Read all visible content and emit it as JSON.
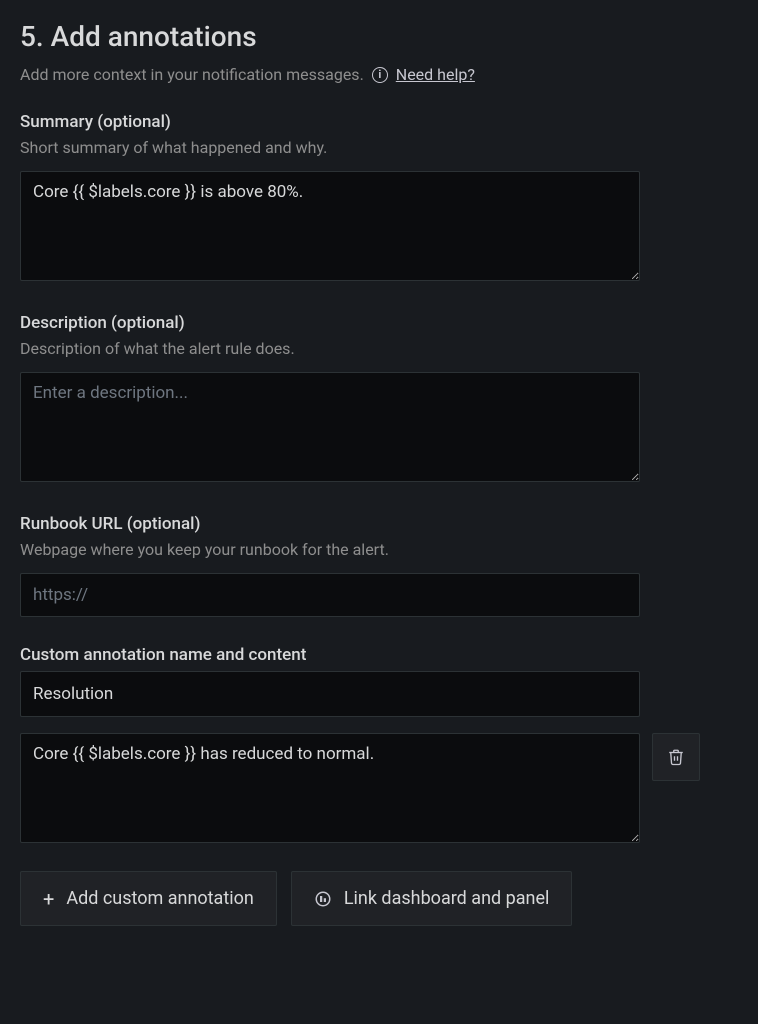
{
  "section": {
    "title": "5. Add annotations",
    "intro": "Add more context in your notification messages.",
    "help_link": "Need help?"
  },
  "summary": {
    "label": "Summary (optional)",
    "hint": "Short summary of what happened and why.",
    "value": "Core {{ $labels.core }} is above 80%."
  },
  "description": {
    "label": "Description (optional)",
    "hint": "Description of what the alert rule does.",
    "placeholder": "Enter a description...",
    "value": ""
  },
  "runbook": {
    "label": "Runbook URL (optional)",
    "hint": "Webpage where you keep your runbook for the alert.",
    "placeholder": "https://",
    "value": ""
  },
  "custom": {
    "section_label": "Custom annotation name and content",
    "name_value": "Resolution",
    "content_value": "Core {{ $labels.core }} has reduced to normal."
  },
  "buttons": {
    "add_custom": "Add custom annotation",
    "link_dashboard": "Link dashboard and panel"
  }
}
